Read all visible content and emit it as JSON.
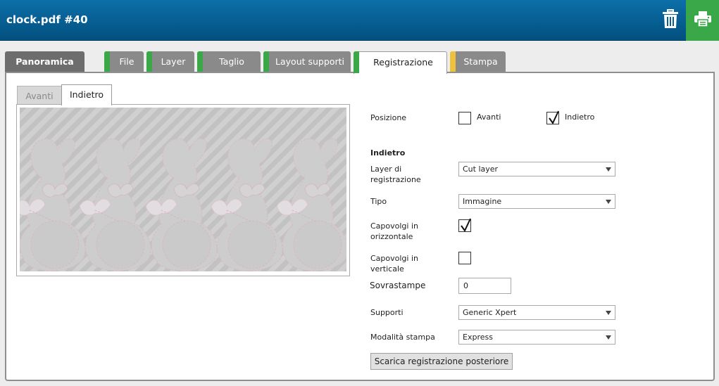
{
  "header": {
    "title": "clock.pdf #40",
    "trash_icon": "trash-icon",
    "print_icon": "printer-icon",
    "colors": {
      "header_top": "#0c6fa8",
      "header_bottom": "#02507f",
      "print_bg": "#3aa848"
    }
  },
  "tabs": [
    {
      "label": "Panoramica",
      "status": "none"
    },
    {
      "label": "File",
      "status": "#3aa848"
    },
    {
      "label": "Layer",
      "status": "#3aa848"
    },
    {
      "label": "Taglio",
      "status": "#3aa848"
    },
    {
      "label": "Layout supporti",
      "status": "#3aa848"
    },
    {
      "label": "Registrazione",
      "status": "#3aa848",
      "active": true
    },
    {
      "label": "Stampa",
      "status": "#f0c23c"
    }
  ],
  "side_tabs": {
    "front": "Avanti",
    "back": "Indietro",
    "active": "back"
  },
  "form": {
    "position": {
      "label": "Posizione",
      "front_label": "Avanti",
      "front_checked": false,
      "back_label": "Indietro",
      "back_checked": true
    },
    "section_title": "Indietro",
    "registration_layer": {
      "label_line1": "Layer di",
      "label_line2": "registrazione",
      "value": "Cut layer"
    },
    "type": {
      "label": "Tipo",
      "value": "Immagine"
    },
    "flip_horizontal": {
      "label_line1": "Capovolgi in",
      "label_line2": "orizzontale",
      "checked": true
    },
    "flip_vertical": {
      "label_line1": "Capovolgi in",
      "label_line2": "verticale",
      "checked": false
    },
    "overprints": {
      "label": "Sovrastampe",
      "value": "0"
    },
    "media": {
      "label": "Supporti",
      "value": "Generic Xpert"
    },
    "print_mode": {
      "label": "Modalità stampa",
      "value": "Express"
    },
    "download_button": "Scarica registrazione posteriore"
  }
}
